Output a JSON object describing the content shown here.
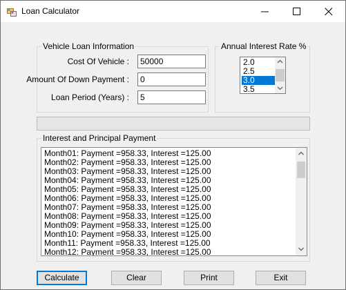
{
  "window": {
    "title": "Loan Calculator",
    "icon": "loan-calculator-app-icon"
  },
  "title_bar_buttons": [
    "minimize-icon",
    "maximize-icon",
    "close-icon"
  ],
  "vehicle_group": {
    "title": "Vehicle  Loan Information",
    "fields": [
      {
        "label": "Cost Of Vehicle :",
        "value": "50000"
      },
      {
        "label": "Amount Of Down Payment :",
        "value": "0"
      },
      {
        "label": "Loan Period (Years) :",
        "value": "5"
      }
    ]
  },
  "rate_group": {
    "title": "Annual Interest Rate %",
    "options": [
      "2.0",
      "2.5",
      "3.0",
      "3.5"
    ],
    "selected": "3.0"
  },
  "progress": {
    "value": 0
  },
  "payments_group": {
    "title": "Interest and Principal Payment",
    "rows": [
      "Month01: Payment =958.33, Interest =125.00",
      "Month02: Payment =958.33, Interest =125.00",
      "Month03: Payment =958.33, Interest =125.00",
      "Month04: Payment =958.33, Interest =125.00",
      "Month05: Payment =958.33, Interest =125.00",
      "Month06: Payment =958.33, Interest =125.00",
      "Month07: Payment =958.33, Interest =125.00",
      "Month08: Payment =958.33, Interest =125.00",
      "Month09: Payment =958.33, Interest =125.00",
      "Month10: Payment =958.33, Interest =125.00",
      "Month11: Payment =958.33, Interest =125.00",
      "Month12: Payment =958.33, Interest =125.00"
    ]
  },
  "buttons": {
    "calculate": "Calculate",
    "clear": "Clear",
    "print": "Print",
    "exit": "Exit"
  },
  "colors": {
    "selection": "#0078d7",
    "default_button_border": "#0078d7"
  }
}
